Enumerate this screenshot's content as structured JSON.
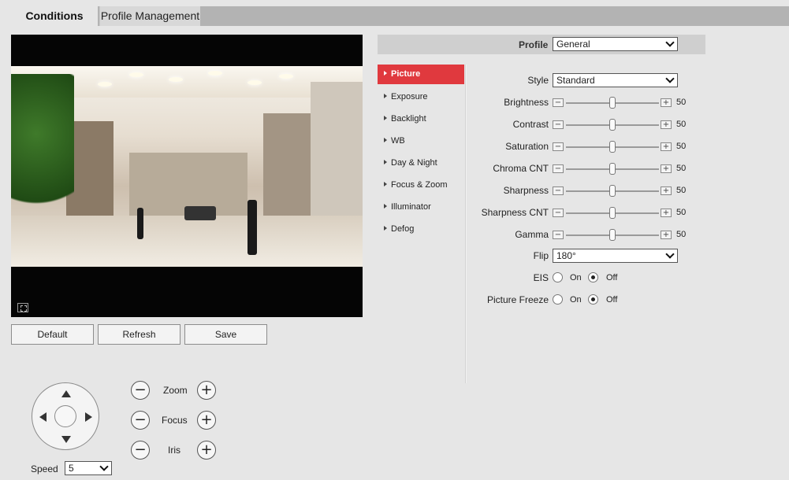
{
  "tabs": [
    {
      "label": "Conditions"
    },
    {
      "label": "Profile Management"
    }
  ],
  "buttons": {
    "default": "Default",
    "refresh": "Refresh",
    "save": "Save"
  },
  "ptz": {
    "zoom": "Zoom",
    "focus": "Focus",
    "iris": "Iris",
    "minus": "−",
    "plus": "+",
    "speed_label": "Speed",
    "speed_value": "5"
  },
  "profile": {
    "label": "Profile",
    "value": "General"
  },
  "menu": [
    {
      "label": "Picture"
    },
    {
      "label": "Exposure"
    },
    {
      "label": "Backlight"
    },
    {
      "label": "WB"
    },
    {
      "label": "Day & Night"
    },
    {
      "label": "Focus & Zoom"
    },
    {
      "label": "Illuminator"
    },
    {
      "label": "Defog"
    }
  ],
  "settings": {
    "style": {
      "label": "Style",
      "value": "Standard"
    },
    "sliders": [
      {
        "label": "Brightness",
        "value": "50",
        "fraction": 0.5
      },
      {
        "label": "Contrast",
        "value": "50",
        "fraction": 0.5
      },
      {
        "label": "Saturation",
        "value": "50",
        "fraction": 0.5
      },
      {
        "label": "Chroma CNT",
        "value": "50",
        "fraction": 0.5
      },
      {
        "label": "Sharpness",
        "value": "50",
        "fraction": 0.5
      },
      {
        "label": "Sharpness CNT",
        "value": "50",
        "fraction": 0.5
      },
      {
        "label": "Gamma",
        "value": "50",
        "fraction": 0.5
      }
    ],
    "flip": {
      "label": "Flip",
      "value": "180°"
    },
    "eis": {
      "label": "EIS",
      "on": "On",
      "off": "Off",
      "selected": "Off"
    },
    "freeze": {
      "label": "Picture Freeze",
      "on": "On",
      "off": "Off",
      "selected": "Off"
    },
    "slider_minus": "−",
    "slider_plus": "+"
  },
  "colors": {
    "accent": "#e0393e"
  }
}
